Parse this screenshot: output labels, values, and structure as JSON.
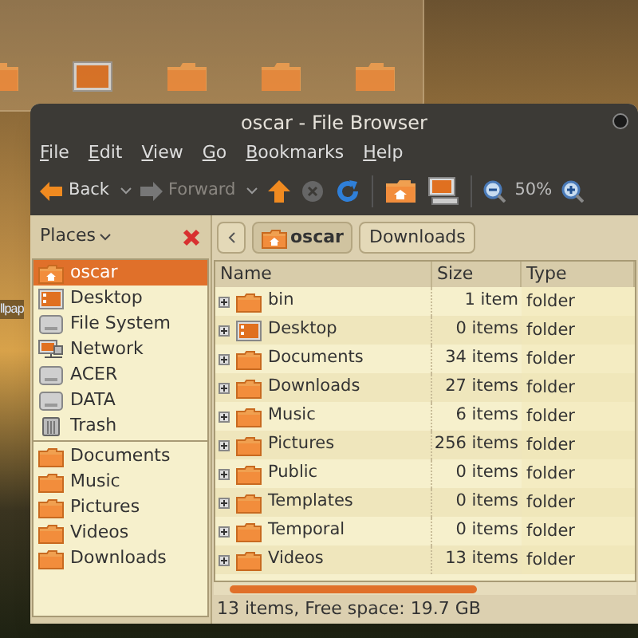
{
  "window": {
    "title": "oscar - File Browser"
  },
  "desktop_label": "llpap",
  "menu": [
    "File",
    "Edit",
    "View",
    "Go",
    "Bookmarks",
    "Help"
  ],
  "toolbar": [
    {
      "kind": "back",
      "label": "Back",
      "disabled": false
    },
    {
      "kind": "forward",
      "label": "Forward",
      "disabled": true
    },
    {
      "kind": "up",
      "disabled": false
    },
    {
      "kind": "stop",
      "disabled": true
    },
    {
      "kind": "reload",
      "disabled": false
    },
    {
      "kind": "home",
      "disabled": false
    },
    {
      "kind": "computer",
      "disabled": false
    },
    {
      "kind": "zoom-out",
      "disabled": false
    },
    {
      "kind": "zoom-level",
      "label": "50%"
    },
    {
      "kind": "zoom-in",
      "disabled": false
    }
  ],
  "sidebar": {
    "title": "Places",
    "items": [
      {
        "label": "oscar",
        "kind": "home",
        "selected": true
      },
      {
        "label": "Desktop",
        "kind": "desktop",
        "selected": false
      },
      {
        "label": "File System",
        "kind": "drive",
        "selected": false
      },
      {
        "label": "Network",
        "kind": "network",
        "selected": false
      },
      {
        "label": "ACER",
        "kind": "drive",
        "selected": false
      },
      {
        "label": "DATA",
        "kind": "drive",
        "selected": false
      },
      {
        "label": "Trash",
        "kind": "trash",
        "selected": false
      }
    ],
    "bookmarks": [
      {
        "label": "Documents",
        "selected": false
      },
      {
        "label": "Music",
        "selected": false
      },
      {
        "label": "Pictures",
        "selected": false
      },
      {
        "label": "Videos",
        "selected": false
      },
      {
        "label": "Downloads",
        "selected": false
      }
    ]
  },
  "path_bar": [
    {
      "label": "oscar",
      "selected": true
    },
    {
      "label": "Downloads",
      "selected": false
    }
  ],
  "table": {
    "columns": [
      "Name",
      "Size",
      "Type"
    ],
    "rows": [
      {
        "name": "bin",
        "size": "1 item",
        "type": "folder",
        "kind": "folder"
      },
      {
        "name": "Desktop",
        "size": "0 items",
        "type": "folder",
        "kind": "desktop"
      },
      {
        "name": "Documents",
        "size": "34 items",
        "type": "folder",
        "kind": "folder"
      },
      {
        "name": "Downloads",
        "size": "27 items",
        "type": "folder",
        "kind": "folder"
      },
      {
        "name": "Music",
        "size": "6 items",
        "type": "folder",
        "kind": "folder"
      },
      {
        "name": "Pictures",
        "size": "256 items",
        "type": "folder",
        "kind": "folder"
      },
      {
        "name": "Public",
        "size": "0 items",
        "type": "folder",
        "kind": "folder"
      },
      {
        "name": "Templates",
        "size": "0 items",
        "type": "folder",
        "kind": "folder"
      },
      {
        "name": "Temporal",
        "size": "0 items",
        "type": "folder",
        "kind": "folder"
      },
      {
        "name": "Videos",
        "size": "13 items",
        "type": "folder",
        "kind": "folder"
      }
    ]
  },
  "status_bar": "13 items, Free space: 19.7 GB"
}
